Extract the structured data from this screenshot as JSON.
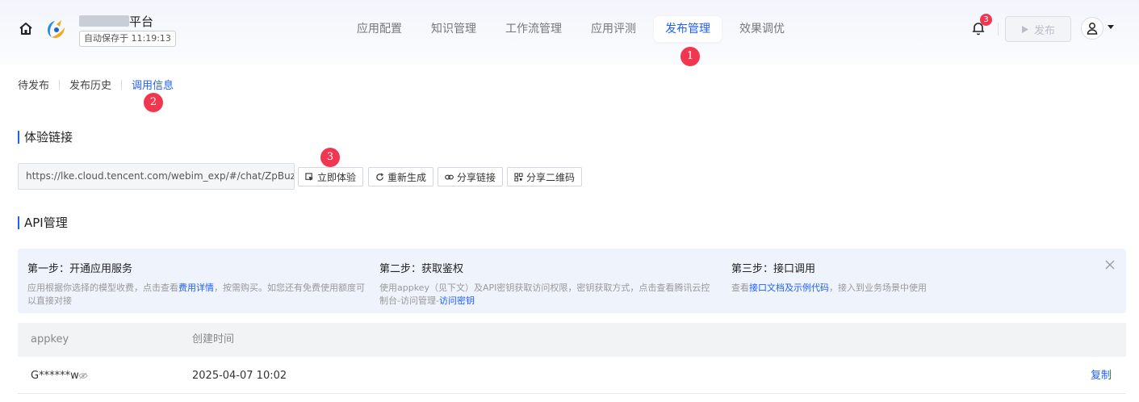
{
  "header": {
    "app_name_suffix": "平台",
    "autosave_label": "自动保存于 11:19:13",
    "notification_count": "3",
    "publish_label": "发布"
  },
  "nav": {
    "items": [
      {
        "label": "应用配置"
      },
      {
        "label": "知识管理"
      },
      {
        "label": "工作流管理"
      },
      {
        "label": "应用评测"
      },
      {
        "label": "发布管理",
        "active": true
      },
      {
        "label": "效果调优"
      }
    ]
  },
  "annotations": [
    "1",
    "2",
    "3"
  ],
  "subtabs": [
    {
      "label": "待发布"
    },
    {
      "label": "发布历史"
    },
    {
      "label": "调用信息",
      "active": true
    }
  ],
  "experience": {
    "title": "体验链接",
    "link_value": "https://lke.cloud.tencent.com/webim_exp/#/chat/ZpBuzf",
    "buttons": {
      "try_now": "立即体验",
      "regenerate": "重新生成",
      "share_link": "分享链接",
      "share_qr": "分享二维码"
    }
  },
  "api": {
    "title": "API管理",
    "steps": [
      {
        "title": "第一步：开通应用服务",
        "desc_pre": "应用根据你选择的模型收费，点击查看",
        "link": "费用详情",
        "desc_post": "，按需购买。如您还有免费使用额度可以直接对接"
      },
      {
        "title": "第二步：获取鉴权",
        "desc_pre": "使用appkey（见下文）及API密钥获取访问权限，密钥获取方式，点击查看腾讯云控制台-访问管理-",
        "link": "访问密钥",
        "desc_post": ""
      },
      {
        "title": "第三步：接口调用",
        "desc_pre": "查看",
        "link": "接口文档及示例代码",
        "desc_post": "，接入到业务场景中使用"
      }
    ],
    "table": {
      "headers": [
        "appkey",
        "创建时间"
      ],
      "rows": [
        {
          "appkey": "G******w",
          "created": "2025-04-07 10:02",
          "action": "复制"
        }
      ]
    }
  },
  "colors": {
    "accent": "#1f5fff",
    "badge": "#f2364f"
  }
}
